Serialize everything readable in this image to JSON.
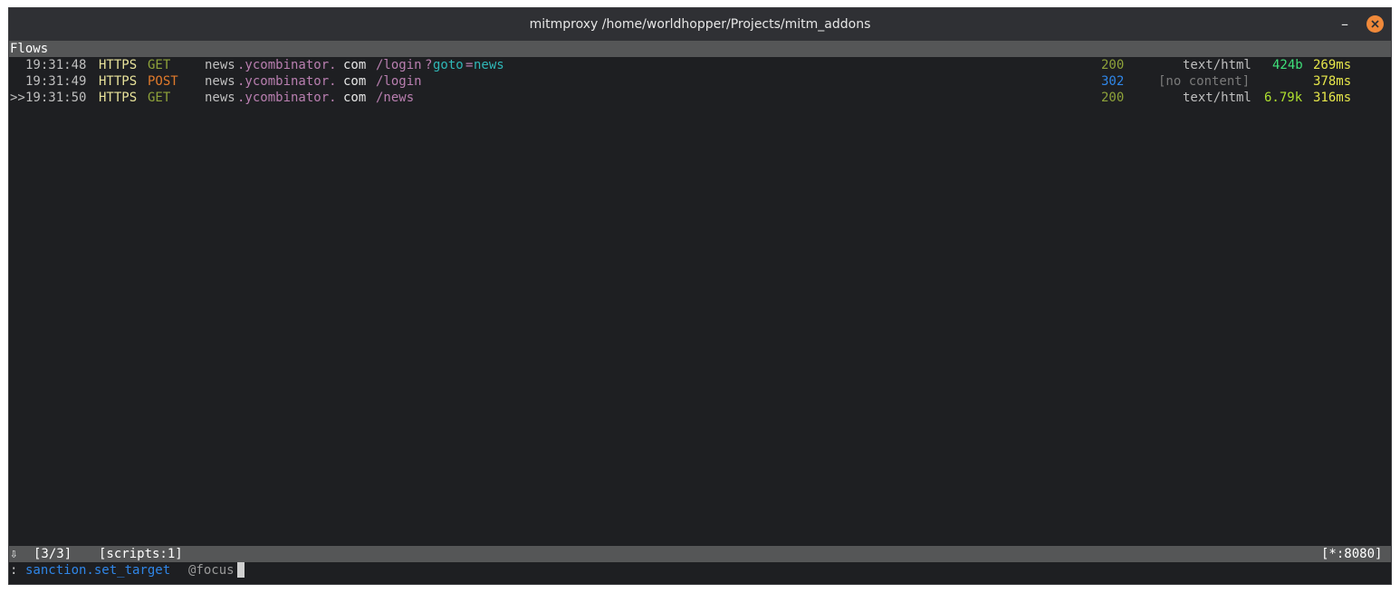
{
  "window": {
    "title": "mitmproxy /home/worldhopper/Projects/mitm_addons",
    "minimize_glyph": "–",
    "close_glyph": "✕"
  },
  "header": {
    "label": "Flows"
  },
  "flows": [
    {
      "marker": "  ",
      "time": "19:31:48",
      "scheme": "HTTPS",
      "method": "GET",
      "host_prefix": "news",
      "host_mid": ".ycombinator.",
      "host_tld": "com",
      "path": "/login",
      "query_sep": "?",
      "query_key": "goto",
      "query_eq": "=",
      "query_val": "news",
      "status": "200",
      "content_type": "text/html",
      "size": "424b",
      "duration": "269ms"
    },
    {
      "marker": "  ",
      "time": "19:31:49",
      "scheme": "HTTPS",
      "method": "POST",
      "host_prefix": "news",
      "host_mid": ".ycombinator.",
      "host_tld": "com",
      "path": "/login",
      "query_sep": "",
      "query_key": "",
      "query_eq": "",
      "query_val": "",
      "status": "302",
      "content_type": "[no content]",
      "size": "",
      "duration": "378ms"
    },
    {
      "marker": ">>",
      "time": "19:31:50",
      "scheme": "HTTPS",
      "method": "GET",
      "host_prefix": "news",
      "host_mid": ".ycombinator.",
      "host_tld": "com",
      "path": "/news",
      "query_sep": "",
      "query_key": "",
      "query_eq": "",
      "query_val": "",
      "status": "200",
      "content_type": "text/html",
      "size": "6.79k",
      "duration": "316ms"
    }
  ],
  "status_bar": {
    "arrow": "⇩",
    "count": "[3/3]",
    "scripts": "[scripts:1]",
    "listen": "[*:8080]"
  },
  "command_line": {
    "prompt": ":",
    "command": "sanction.set_target",
    "argument": "@focus"
  }
}
